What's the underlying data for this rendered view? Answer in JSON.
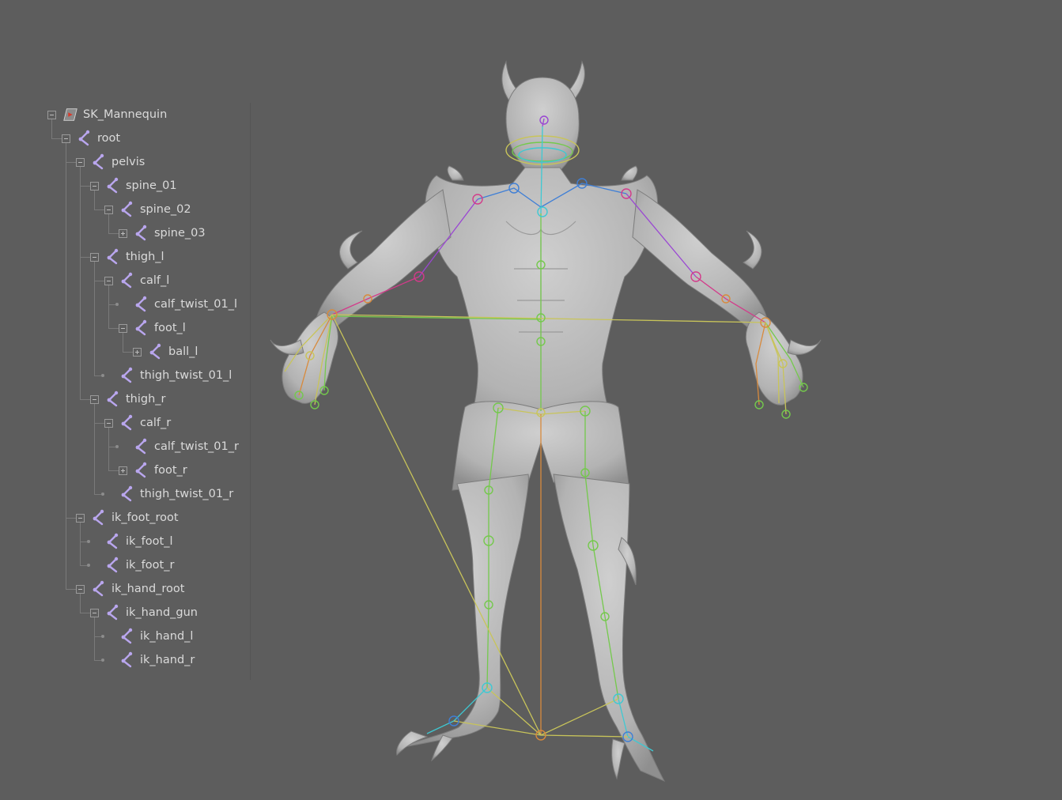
{
  "outliner": {
    "root_item": {
      "label": "SK_Mannequin",
      "icon": "mesh-icon"
    },
    "joint_icon": "joint-icon",
    "items": [
      {
        "label": "root",
        "depth": 1,
        "state": "expanded"
      },
      {
        "label": "pelvis",
        "depth": 2,
        "state": "expanded"
      },
      {
        "label": "spine_01",
        "depth": 3,
        "state": "expanded"
      },
      {
        "label": "spine_02",
        "depth": 4,
        "state": "expanded"
      },
      {
        "label": "spine_03",
        "depth": 5,
        "state": "collapsed"
      },
      {
        "label": "thigh_l",
        "depth": 3,
        "state": "expanded"
      },
      {
        "label": "calf_l",
        "depth": 4,
        "state": "expanded"
      },
      {
        "label": "calf_twist_01_l",
        "depth": 5,
        "state": "leaf"
      },
      {
        "label": "foot_l",
        "depth": 5,
        "state": "expanded"
      },
      {
        "label": "ball_l",
        "depth": 6,
        "state": "collapsed"
      },
      {
        "label": "thigh_twist_01_l",
        "depth": 4,
        "state": "leaf"
      },
      {
        "label": "thigh_r",
        "depth": 3,
        "state": "expanded"
      },
      {
        "label": "calf_r",
        "depth": 4,
        "state": "expanded"
      },
      {
        "label": "calf_twist_01_r",
        "depth": 5,
        "state": "leaf"
      },
      {
        "label": "foot_r",
        "depth": 5,
        "state": "collapsed"
      },
      {
        "label": "thigh_twist_01_r",
        "depth": 4,
        "state": "leaf"
      },
      {
        "label": "ik_foot_root",
        "depth": 2,
        "state": "expanded"
      },
      {
        "label": "ik_foot_l",
        "depth": 3,
        "state": "leaf"
      },
      {
        "label": "ik_foot_r",
        "depth": 3,
        "state": "leaf"
      },
      {
        "label": "ik_hand_root",
        "depth": 2,
        "state": "expanded"
      },
      {
        "label": "ik_hand_gun",
        "depth": 3,
        "state": "expanded"
      },
      {
        "label": "ik_hand_l",
        "depth": 4,
        "state": "leaf"
      },
      {
        "label": "ik_hand_r",
        "depth": 4,
        "state": "leaf"
      }
    ]
  },
  "colors": {
    "background": "#5d5d5d",
    "mesh": "#bdbdbd",
    "joint_icon": "#b9a6ee",
    "bone_cyan": "#3ec9d3",
    "bone_green": "#74c94c",
    "bone_yellow": "#c8c45a",
    "bone_orange": "#d88a3c",
    "bone_magenta": "#d33a8a",
    "bone_purple": "#9a46d3",
    "bone_blue": "#3f7fd6"
  }
}
